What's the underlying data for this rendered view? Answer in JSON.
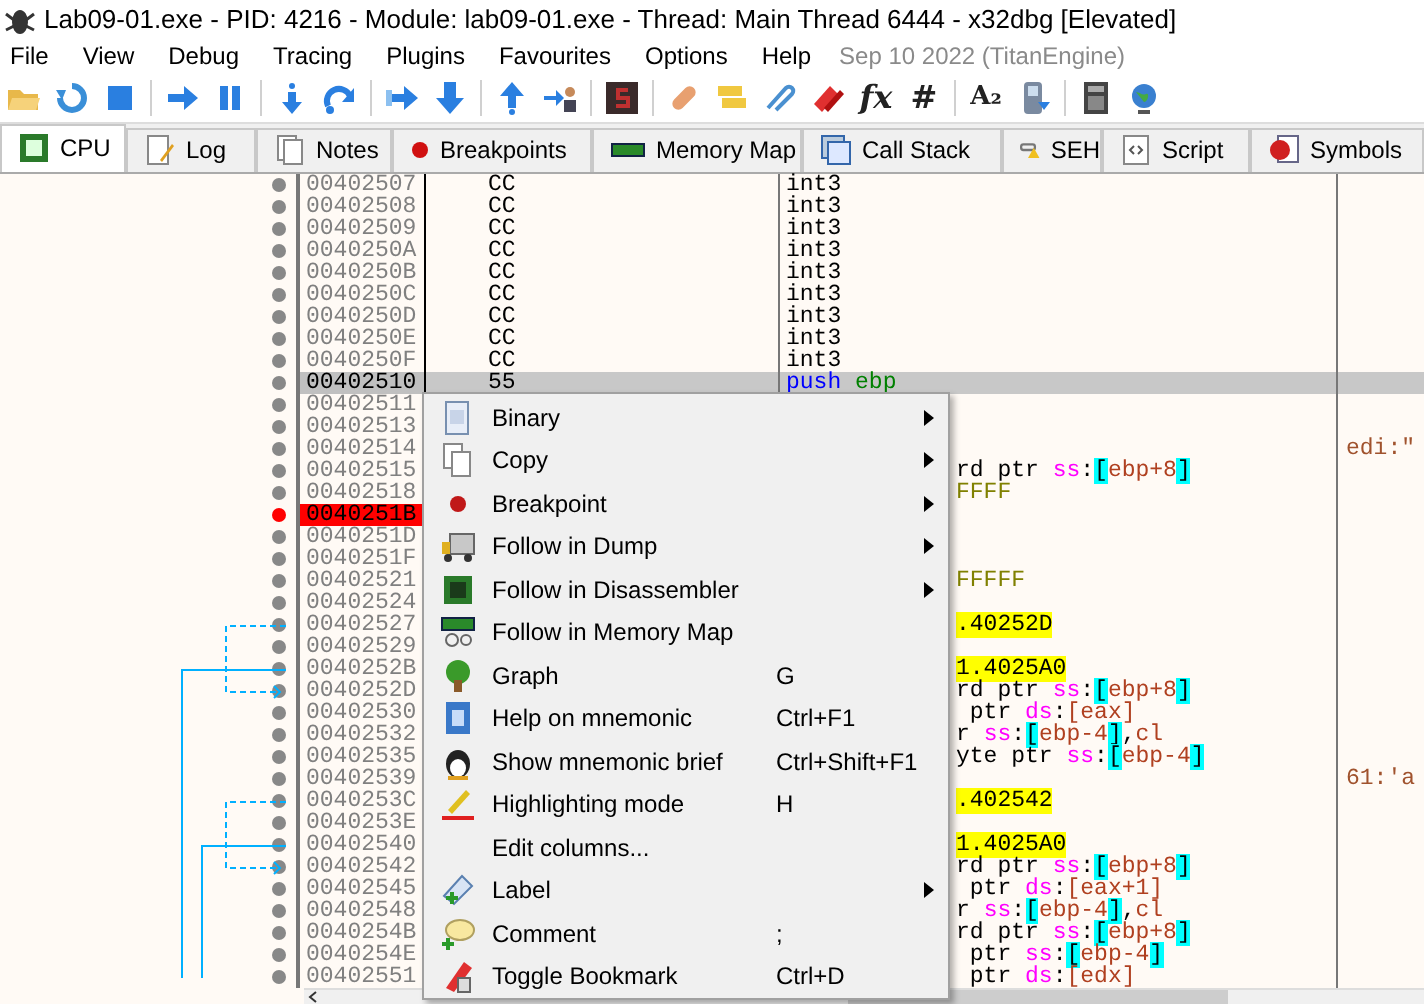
{
  "window": {
    "title": "Lab09-01.exe - PID: 4216 - Module: lab09-01.exe - Thread: Main Thread 6444 - x32dbg [Elevated]"
  },
  "menu_bar": [
    "File",
    "View",
    "Debug",
    "Tracing",
    "Plugins",
    "Favourites",
    "Options",
    "Help"
  ],
  "build_info": "Sep 10 2022 (TitanEngine)",
  "toolbar_glyphs": [
    "fx",
    "#",
    "A₂"
  ],
  "tabs": [
    {
      "label": "CPU",
      "selected": true
    },
    {
      "label": "Log",
      "selected": false
    },
    {
      "label": "Notes",
      "selected": false
    },
    {
      "label": "Breakpoints",
      "selected": false
    },
    {
      "label": "Memory Map",
      "selected": false
    },
    {
      "label": "Call Stack",
      "selected": false
    },
    {
      "label": "SEH",
      "selected": false
    },
    {
      "label": "Script",
      "selected": false
    },
    {
      "label": "Symbols",
      "selected": false
    }
  ],
  "rows": [
    {
      "address": "00402507",
      "bytes": "CC",
      "instruction": [
        {
          "kind": "txt",
          "text": "int3"
        }
      ],
      "selected": false,
      "breakpoint": false
    },
    {
      "address": "00402508",
      "bytes": "CC",
      "instruction": [
        {
          "kind": "txt",
          "text": "int3"
        }
      ],
      "selected": false,
      "breakpoint": false
    },
    {
      "address": "00402509",
      "bytes": "CC",
      "instruction": [
        {
          "kind": "txt",
          "text": "int3"
        }
      ],
      "selected": false,
      "breakpoint": false
    },
    {
      "address": "0040250A",
      "bytes": "CC",
      "instruction": [
        {
          "kind": "txt",
          "text": "int3"
        }
      ],
      "selected": false,
      "breakpoint": false
    },
    {
      "address": "0040250B",
      "bytes": "CC",
      "instruction": [
        {
          "kind": "txt",
          "text": "int3"
        }
      ],
      "selected": false,
      "breakpoint": false
    },
    {
      "address": "0040250C",
      "bytes": "CC",
      "instruction": [
        {
          "kind": "txt",
          "text": "int3"
        }
      ],
      "selected": false,
      "breakpoint": false
    },
    {
      "address": "0040250D",
      "bytes": "CC",
      "instruction": [
        {
          "kind": "txt",
          "text": "int3"
        }
      ],
      "selected": false,
      "breakpoint": false
    },
    {
      "address": "0040250E",
      "bytes": "CC",
      "instruction": [
        {
          "kind": "txt",
          "text": "int3"
        }
      ],
      "selected": false,
      "breakpoint": false
    },
    {
      "address": "0040250F",
      "bytes": "CC",
      "instruction": [
        {
          "kind": "txt",
          "text": "int3"
        }
      ],
      "selected": false,
      "breakpoint": false
    },
    {
      "address": "00402510",
      "bytes": "55",
      "instruction": [
        {
          "kind": "kw",
          "text": "push"
        },
        {
          "kind": "sreg",
          "text": " ebp"
        }
      ],
      "selected": true,
      "breakpoint": false
    },
    {
      "address": "00402511",
      "selected": false,
      "breakpoint": false
    },
    {
      "address": "00402513",
      "selected": false,
      "breakpoint": false
    },
    {
      "address": "00402514",
      "comment": "edi:\"",
      "selected": false,
      "breakpoint": false
    },
    {
      "address": "00402515",
      "instruction": [
        {
          "kind": "txt",
          "text": "rd ptr "
        },
        {
          "kind": "seg",
          "text": "ss"
        },
        {
          "kind": "txt",
          "text": ":"
        },
        {
          "kind": "br",
          "text": "["
        },
        {
          "kind": "reg",
          "text": "ebp+8"
        },
        {
          "kind": "br",
          "text": "]"
        }
      ],
      "selected": false,
      "breakpoint": false
    },
    {
      "address": "00402518",
      "instruction": [
        {
          "kind": "num",
          "text": "FFFF"
        }
      ],
      "selected": false,
      "breakpoint": false
    },
    {
      "address": "0040251B",
      "selected": false,
      "breakpoint": true
    },
    {
      "address": "0040251D",
      "selected": false,
      "breakpoint": false
    },
    {
      "address": "0040251F",
      "selected": false,
      "breakpoint": false
    },
    {
      "address": "00402521",
      "instruction": [
        {
          "kind": "num",
          "text": "FFFFF"
        }
      ],
      "selected": false,
      "breakpoint": false
    },
    {
      "address": "00402524",
      "selected": false,
      "breakpoint": false
    },
    {
      "address": "00402527",
      "instruction": [
        {
          "kind": "addr",
          "text": ".40252D"
        }
      ],
      "selected": false,
      "breakpoint": false
    },
    {
      "address": "00402529",
      "selected": false,
      "breakpoint": false
    },
    {
      "address": "0040252B",
      "instruction": [
        {
          "kind": "addr",
          "text": "1.4025A0"
        }
      ],
      "selected": false,
      "breakpoint": false
    },
    {
      "address": "0040252D",
      "instruction": [
        {
          "kind": "txt",
          "text": "rd ptr "
        },
        {
          "kind": "seg",
          "text": "ss"
        },
        {
          "kind": "txt",
          "text": ":"
        },
        {
          "kind": "br",
          "text": "["
        },
        {
          "kind": "reg",
          "text": "ebp+8"
        },
        {
          "kind": "br",
          "text": "]"
        }
      ],
      "selected": false,
      "breakpoint": false
    },
    {
      "address": "00402530",
      "instruction": [
        {
          "kind": "txt",
          "text": " ptr "
        },
        {
          "kind": "seg",
          "text": "ds"
        },
        {
          "kind": "txt",
          "text": ":"
        },
        {
          "kind": "reg",
          "text": "[eax]"
        }
      ],
      "selected": false,
      "breakpoint": false
    },
    {
      "address": "00402532",
      "instruction": [
        {
          "kind": "txt",
          "text": "r "
        },
        {
          "kind": "seg",
          "text": "ss"
        },
        {
          "kind": "txt",
          "text": ":"
        },
        {
          "kind": "br",
          "text": "["
        },
        {
          "kind": "reg",
          "text": "ebp-4"
        },
        {
          "kind": "br",
          "text": "]"
        },
        {
          "kind": "txt",
          "text": ","
        },
        {
          "kind": "reg",
          "text": "cl"
        }
      ],
      "selected": false,
      "breakpoint": false
    },
    {
      "address": "00402535",
      "instruction": [
        {
          "kind": "txt",
          "text": "yte ptr "
        },
        {
          "kind": "seg",
          "text": "ss"
        },
        {
          "kind": "txt",
          "text": ":"
        },
        {
          "kind": "br",
          "text": "["
        },
        {
          "kind": "reg",
          "text": "ebp-4"
        },
        {
          "kind": "br",
          "text": "]"
        }
      ],
      "selected": false,
      "breakpoint": false
    },
    {
      "address": "00402539",
      "comment": "61:'a",
      "selected": false,
      "breakpoint": false
    },
    {
      "address": "0040253C",
      "instruction": [
        {
          "kind": "addr",
          "text": ".402542"
        }
      ],
      "selected": false,
      "breakpoint": false
    },
    {
      "address": "0040253E",
      "selected": false,
      "breakpoint": false
    },
    {
      "address": "00402540",
      "instruction": [
        {
          "kind": "addr",
          "text": "1.4025A0"
        }
      ],
      "selected": false,
      "breakpoint": false
    },
    {
      "address": "00402542",
      "instruction": [
        {
          "kind": "txt",
          "text": "rd ptr "
        },
        {
          "kind": "seg",
          "text": "ss"
        },
        {
          "kind": "txt",
          "text": ":"
        },
        {
          "kind": "br",
          "text": "["
        },
        {
          "kind": "reg",
          "text": "ebp+8"
        },
        {
          "kind": "br",
          "text": "]"
        }
      ],
      "selected": false,
      "breakpoint": false
    },
    {
      "address": "00402545",
      "instruction": [
        {
          "kind": "txt",
          "text": " ptr "
        },
        {
          "kind": "seg",
          "text": "ds"
        },
        {
          "kind": "txt",
          "text": ":"
        },
        {
          "kind": "reg",
          "text": "[eax+1]"
        }
      ],
      "selected": false,
      "breakpoint": false
    },
    {
      "address": "00402548",
      "instruction": [
        {
          "kind": "txt",
          "text": "r "
        },
        {
          "kind": "seg",
          "text": "ss"
        },
        {
          "kind": "txt",
          "text": ":"
        },
        {
          "kind": "br",
          "text": "["
        },
        {
          "kind": "reg",
          "text": "ebp-4"
        },
        {
          "kind": "br",
          "text": "]"
        },
        {
          "kind": "txt",
          "text": ","
        },
        {
          "kind": "reg",
          "text": "cl"
        }
      ],
      "selected": false,
      "breakpoint": false
    },
    {
      "address": "0040254B",
      "instruction": [
        {
          "kind": "txt",
          "text": "rd ptr "
        },
        {
          "kind": "seg",
          "text": "ss"
        },
        {
          "kind": "txt",
          "text": ":"
        },
        {
          "kind": "br",
          "text": "["
        },
        {
          "kind": "reg",
          "text": "ebp+8"
        },
        {
          "kind": "br",
          "text": "]"
        }
      ],
      "selected": false,
      "breakpoint": false
    },
    {
      "address": "0040254E",
      "instruction": [
        {
          "kind": "txt",
          "text": " ptr "
        },
        {
          "kind": "seg",
          "text": "ss"
        },
        {
          "kind": "txt",
          "text": ":"
        },
        {
          "kind": "br",
          "text": "["
        },
        {
          "kind": "reg",
          "text": "ebp-4"
        },
        {
          "kind": "br",
          "text": "]"
        }
      ],
      "selected": false,
      "breakpoint": false
    },
    {
      "address": "00402551",
      "instruction": [
        {
          "kind": "txt",
          "text": " ptr "
        },
        {
          "kind": "seg",
          "text": "ds"
        },
        {
          "kind": "txt",
          "text": ":"
        },
        {
          "kind": "reg",
          "text": "[edx]"
        }
      ],
      "selected": false,
      "breakpoint": false
    }
  ],
  "context_menu": [
    {
      "label": "Binary",
      "submenu": true
    },
    {
      "label": "Copy",
      "submenu": true
    },
    {
      "label": "Breakpoint",
      "submenu": true
    },
    {
      "label": "Follow in Dump",
      "submenu": true
    },
    {
      "label": "Follow in Disassembler",
      "submenu": true
    },
    {
      "label": "Follow in Memory Map",
      "submenu": false
    },
    {
      "label": "Graph",
      "shortcut": "G",
      "submenu": false
    },
    {
      "label": "Help on mnemonic",
      "shortcut": "Ctrl+F1",
      "submenu": false
    },
    {
      "label": "Show mnemonic brief",
      "shortcut": "Ctrl+Shift+F1",
      "submenu": false
    },
    {
      "label": "Highlighting mode",
      "shortcut": "H",
      "submenu": false
    },
    {
      "label": "Edit columns...",
      "submenu": false
    },
    {
      "label": "Label",
      "submenu": true
    },
    {
      "label": "Comment",
      "shortcut": ";",
      "submenu": false
    },
    {
      "label": "Toggle Bookmark",
      "shortcut": "Ctrl+D",
      "submenu": false
    }
  ]
}
